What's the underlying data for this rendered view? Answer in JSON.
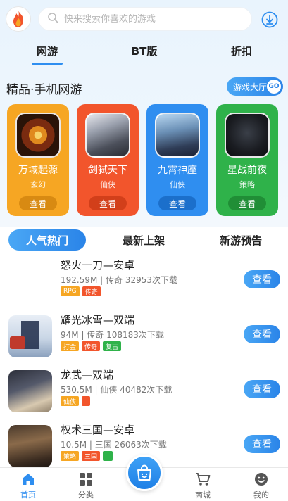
{
  "header": {
    "search_placeholder": "快来搜索你喜欢的游戏",
    "logo_icon": "flame-logo-icon",
    "download_icon": "download-icon"
  },
  "top_tabs": [
    {
      "label": "网游",
      "active": true
    },
    {
      "label": "BT版",
      "active": false
    },
    {
      "label": "折扣",
      "active": false
    }
  ],
  "featured": {
    "title": "精品·手机网游",
    "hall_button": "游戏大厅",
    "hall_badge": "GO",
    "cards": [
      {
        "name": "万域起源",
        "tag": "玄幻",
        "button": "查看",
        "color": "#f6a623",
        "btn_color": "#d88a12"
      },
      {
        "name": "剑弑天下",
        "tag": "仙侠",
        "button": "查看",
        "color": "#f2552c",
        "btn_color": "#d23f1a"
      },
      {
        "name": "九霄神座",
        "tag": "仙侠",
        "button": "查看",
        "color": "#2f8ef0",
        "btn_color": "#1b6fcb"
      },
      {
        "name": "星战前夜",
        "tag": "策略",
        "button": "查看",
        "color": "#2fb24a",
        "btn_color": "#208e36"
      }
    ]
  },
  "list_tabs": [
    {
      "label": "人气热门",
      "active": true
    },
    {
      "label": "最新上架",
      "active": false
    },
    {
      "label": "新游预告",
      "active": false
    }
  ],
  "games": [
    {
      "name": "怒火一刀—安卓",
      "meta": "192.59M | 传奇  32953次下载",
      "button": "查看",
      "tags": [
        {
          "text": "RPG",
          "color": "#f6a623"
        },
        {
          "text": "传奇",
          "color": "#f2552c"
        }
      ]
    },
    {
      "name": "耀光冰雪—双端",
      "meta": "94M | 传奇  108183次下载",
      "button": "查看",
      "tags": [
        {
          "text": "打金",
          "color": "#f6a623"
        },
        {
          "text": "传奇",
          "color": "#f2552c"
        },
        {
          "text": "复古",
          "color": "#2fb24a"
        }
      ]
    },
    {
      "name": "龙武—双端",
      "meta": "530.5M | 仙侠  40482次下载",
      "button": "查看",
      "tags": [
        {
          "text": "仙侠",
          "color": "#f6a623"
        },
        {
          "text": "",
          "color": "#f2552c"
        }
      ]
    },
    {
      "name": "权术三国—安卓",
      "meta": "10.5M | 三国  26063次下载",
      "button": "查看",
      "tags": [
        {
          "text": "策略",
          "color": "#f6a623"
        },
        {
          "text": "三国",
          "color": "#f2552c"
        },
        {
          "text": "",
          "color": "#2fb24a"
        }
      ]
    }
  ],
  "bottom_nav": [
    {
      "label": "首页",
      "icon": "home-icon",
      "active": true
    },
    {
      "label": "分类",
      "icon": "grid-icon",
      "active": false
    },
    {
      "label": "商城",
      "icon": "cart-icon",
      "active": false
    },
    {
      "label": "我的",
      "icon": "face-icon",
      "active": false
    }
  ],
  "center_button_icon": "shopping-bag-icon",
  "colors": {
    "accent": "#2e8ef0"
  }
}
